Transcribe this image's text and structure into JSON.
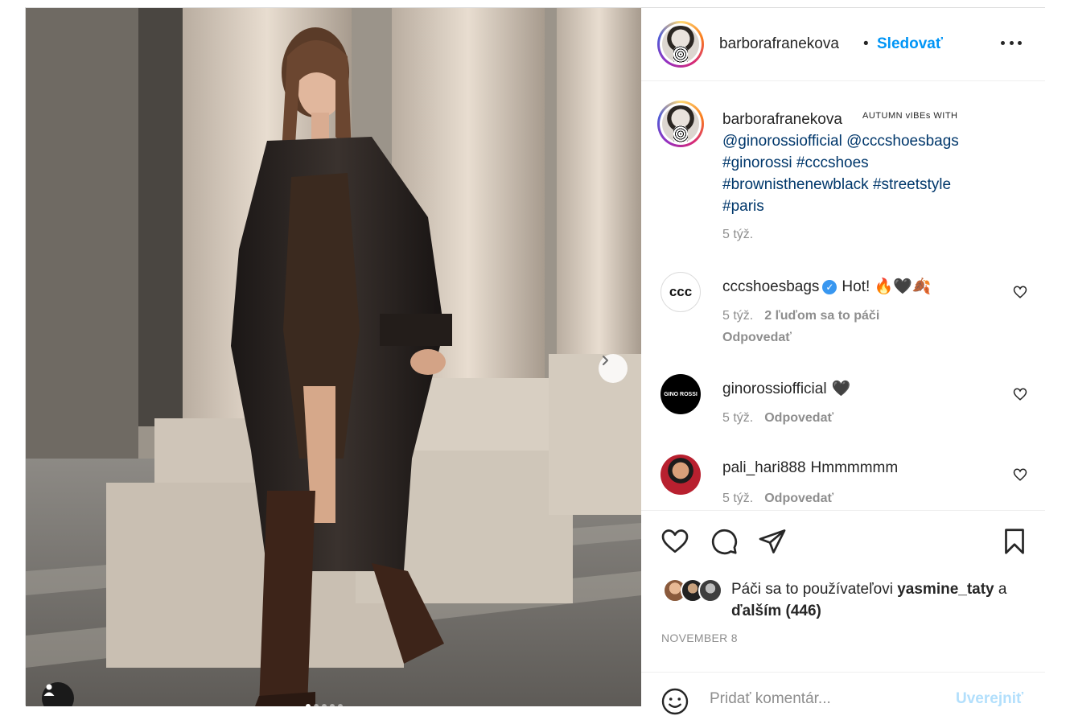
{
  "post": {
    "username": "barborafranekova",
    "follow_label": "Sledovať",
    "separator": "•",
    "caption_tag": "AUTUMN vIBEs WITH",
    "caption_lines": [
      "@ginorossiofficial @cccshoesbags",
      "#ginorossi #cccshoes",
      "#brownisthenewblack #streetstyle",
      "#paris"
    ],
    "caption_time": "5 týž."
  },
  "comments": [
    {
      "username": "cccshoesbags",
      "verified": true,
      "text": "Hot! 🔥🖤🍂",
      "time": "5 týž.",
      "likes": "2 ľuďom sa to páči",
      "reply": "Odpovedať",
      "avatar_label": "ccc"
    },
    {
      "username": "ginorossiofficial",
      "verified": false,
      "text": "🖤",
      "time": "5 týž.",
      "reply": "Odpovedať",
      "avatar_label": "GINO ROSSI"
    },
    {
      "username": "pali_hari888",
      "verified": false,
      "text": "Hmmmmmm",
      "time": "5 týž.",
      "reply": "Odpovedať"
    }
  ],
  "likes": {
    "prefix": "Páči sa to používateľovi",
    "user": "yasmine_taty",
    "connector": "a",
    "others": "ďalším (446)"
  },
  "date": "NOVEMBER 8",
  "composer": {
    "placeholder": "Pridať komentár...",
    "post_label": "Uverejniť"
  },
  "colors": {
    "link": "#00376b",
    "follow": "#0095f6",
    "muted": "#8e8e8e"
  },
  "icons": [
    "heart-icon",
    "comment-icon",
    "share-icon",
    "bookmark-icon",
    "more-icon",
    "smile-icon",
    "user-tag-icon",
    "chevron-right-icon",
    "verified-icon"
  ]
}
